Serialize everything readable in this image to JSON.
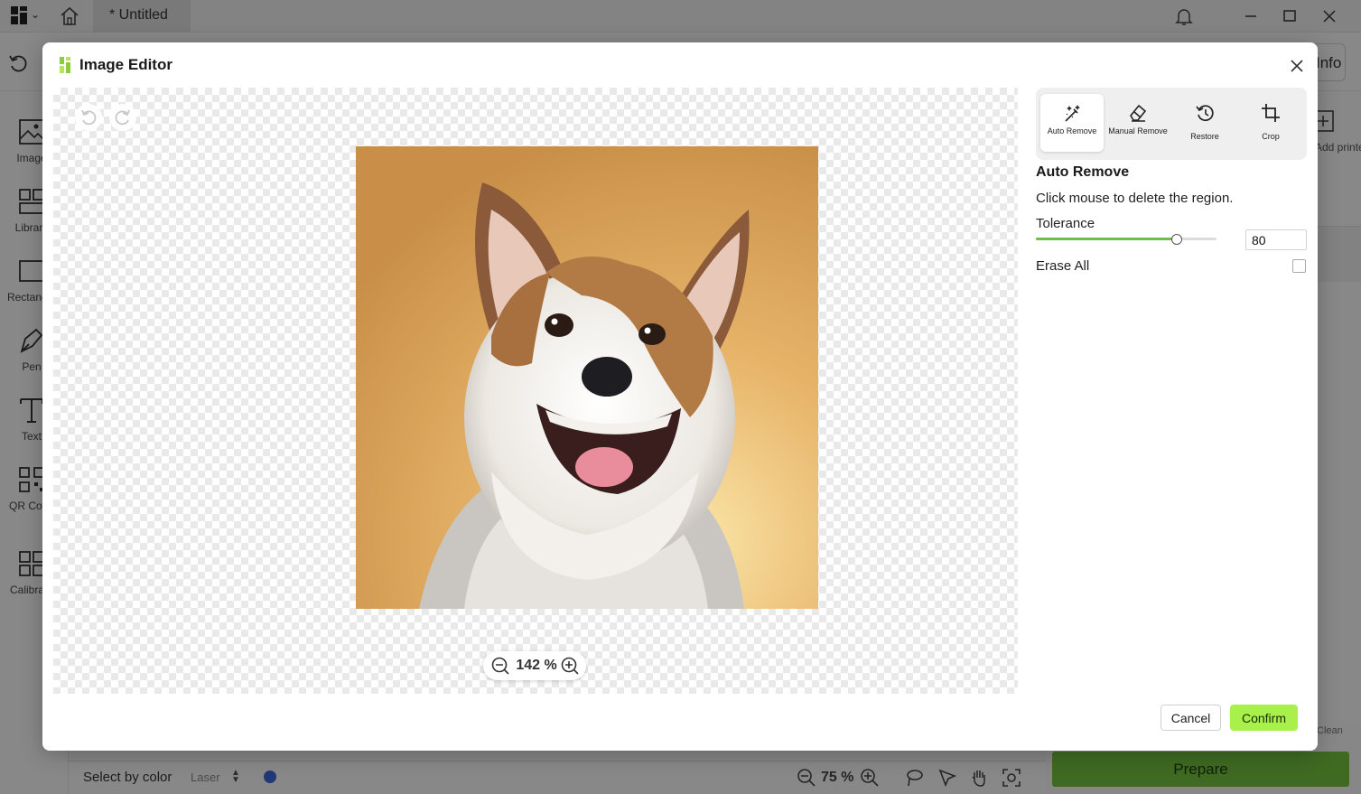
{
  "app": {
    "tab_title": "* Untitled",
    "info_label": "Info",
    "left_rail": [
      {
        "label": "Image",
        "icon": "image-icon"
      },
      {
        "label": "Library",
        "icon": "library-icon"
      },
      {
        "label": "Rectangle",
        "icon": "rectangle-icon"
      },
      {
        "label": "Pen",
        "icon": "pen-icon"
      },
      {
        "label": "Text",
        "icon": "text-icon"
      },
      {
        "label": "QR Code",
        "icon": "qr-code-icon"
      },
      {
        "label": "Calibrate",
        "icon": "calibrate-icon"
      }
    ],
    "add_printer_label": "Add printer",
    "clean_label": "Clean",
    "bottom": {
      "select_by_color": "Select by color",
      "laser_label": "Laser",
      "zoom": "75 %",
      "prepare_label": "Prepare",
      "laser_color": "#3b66d9"
    }
  },
  "modal": {
    "title": "Image Editor",
    "zoom": "142 %",
    "tools": [
      {
        "id": "auto-remove",
        "label": "Auto Remove",
        "active": true
      },
      {
        "id": "manual-remove",
        "label": "Manual Remove",
        "active": false
      },
      {
        "id": "restore",
        "label": "Restore",
        "active": false
      },
      {
        "id": "crop",
        "label": "Crop",
        "active": false
      }
    ],
    "section_title": "Auto Remove",
    "description": "Click mouse to delete the region.",
    "tolerance_label": "Tolerance",
    "tolerance_value": "80",
    "tolerance_fraction": 0.78,
    "erase_all_label": "Erase All",
    "erase_all_checked": false,
    "cancel_label": "Cancel",
    "confirm_label": "Confirm",
    "accent_color": "#a8f04a"
  }
}
